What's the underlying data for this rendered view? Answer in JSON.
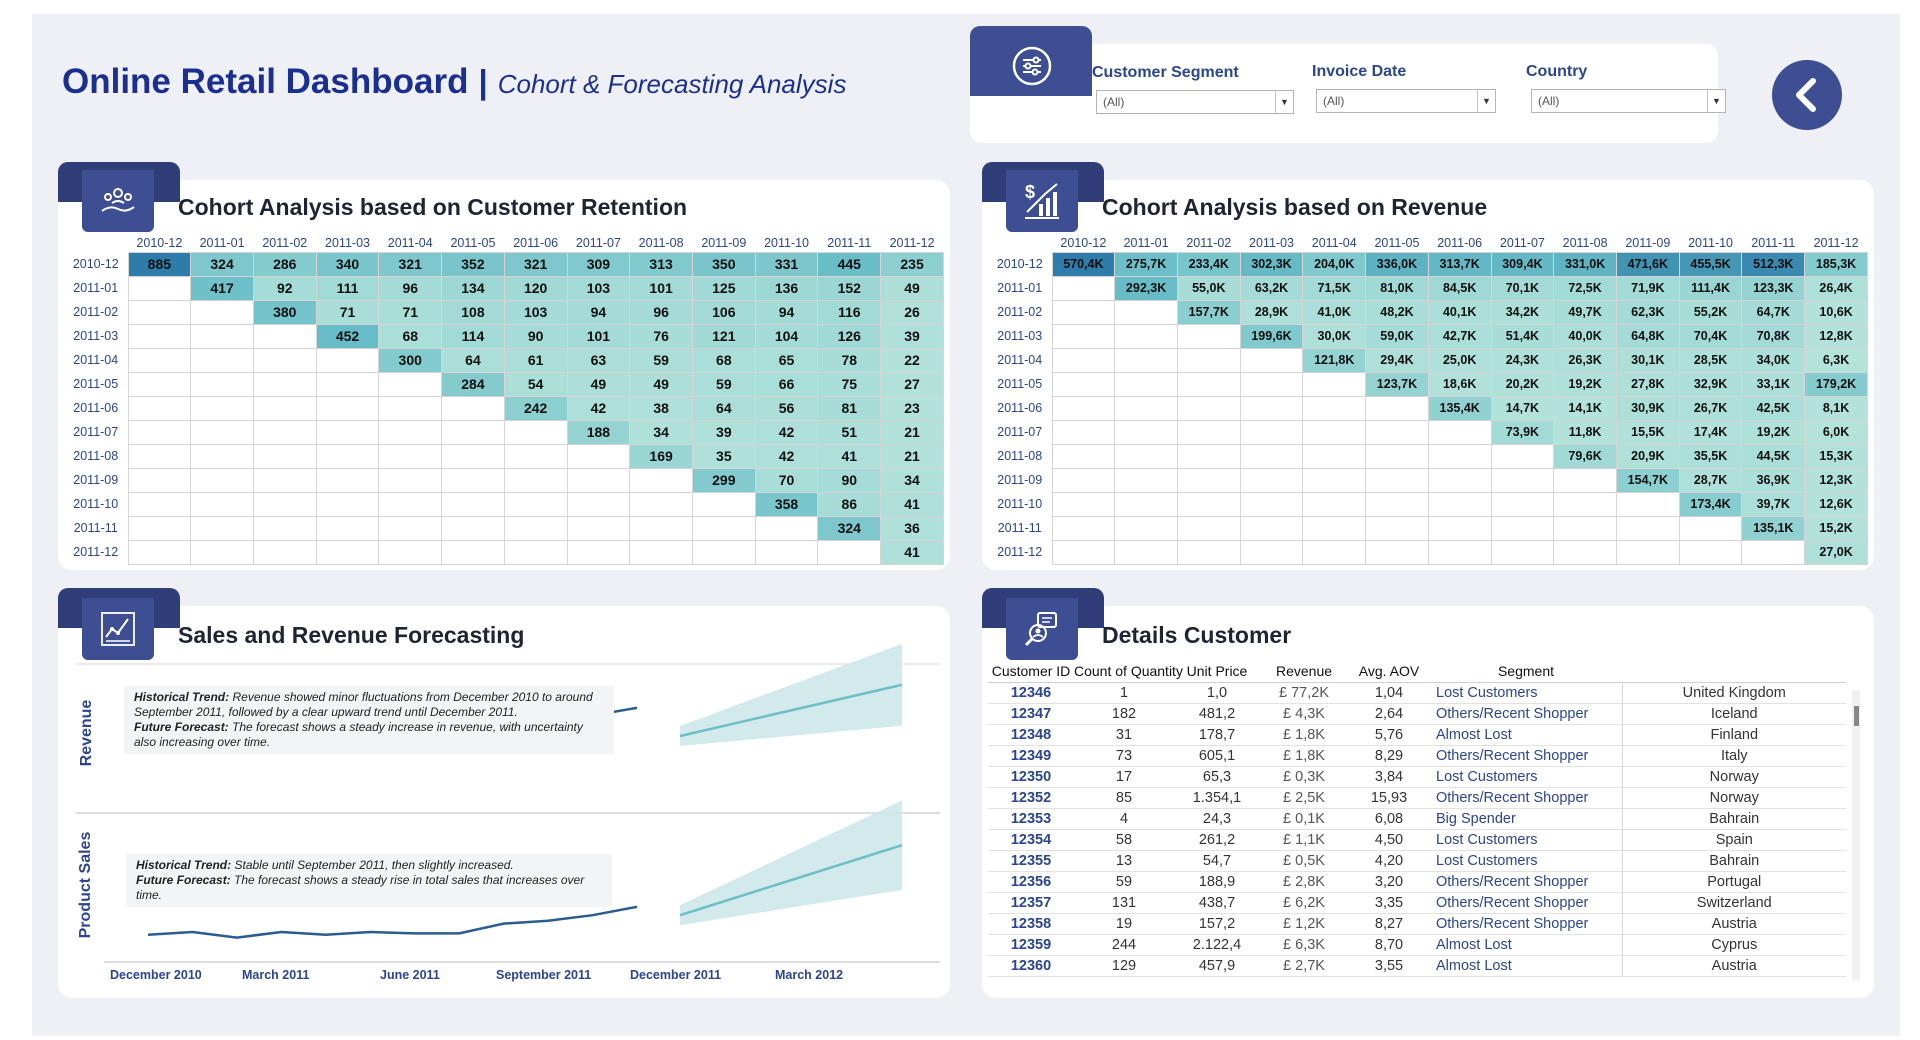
{
  "header": {
    "title": "Online Retail Dashboard",
    "separator": "|",
    "subtitle": "Cohort & Forecasting Analysis"
  },
  "filters": [
    {
      "label": "Customer Segment",
      "value": "(All)"
    },
    {
      "label": "Invoice Date",
      "value": "(All)"
    },
    {
      "label": "Country",
      "value": "(All)"
    }
  ],
  "colors": {
    "brand": "#1b2f8f",
    "tab_dark": "#2f3d78",
    "tab_icon": "#3e4e92",
    "heat_high": "#2f79a9",
    "heat_mid": "#5fb3c3",
    "heat_low": "#a8ddd2",
    "line": "#2b5c8f",
    "forecast": "#6dbec6"
  },
  "retention": {
    "title": "Cohort Analysis based on Customer Retention",
    "icon": "users-hand-icon",
    "columns": [
      "2010-12",
      "2011-01",
      "2011-02",
      "2011-03",
      "2011-04",
      "2011-05",
      "2011-06",
      "2011-07",
      "2011-08",
      "2011-09",
      "2011-10",
      "2011-11",
      "2011-12"
    ],
    "rows": [
      {
        "label": "2010-12",
        "values": [
          "885",
          "324",
          "286",
          "340",
          "321",
          "352",
          "321",
          "309",
          "313",
          "350",
          "331",
          "445",
          "235"
        ]
      },
      {
        "label": "2011-01",
        "values": [
          "",
          "417",
          "92",
          "111",
          "96",
          "134",
          "120",
          "103",
          "101",
          "125",
          "136",
          "152",
          "49"
        ]
      },
      {
        "label": "2011-02",
        "values": [
          "",
          "",
          "380",
          "71",
          "71",
          "108",
          "103",
          "94",
          "96",
          "106",
          "94",
          "116",
          "26"
        ]
      },
      {
        "label": "2011-03",
        "values": [
          "",
          "",
          "",
          "452",
          "68",
          "114",
          "90",
          "101",
          "76",
          "121",
          "104",
          "126",
          "39"
        ]
      },
      {
        "label": "2011-04",
        "values": [
          "",
          "",
          "",
          "",
          "300",
          "64",
          "61",
          "63",
          "59",
          "68",
          "65",
          "78",
          "22"
        ]
      },
      {
        "label": "2011-05",
        "values": [
          "",
          "",
          "",
          "",
          "",
          "284",
          "54",
          "49",
          "49",
          "59",
          "66",
          "75",
          "27"
        ]
      },
      {
        "label": "2011-06",
        "values": [
          "",
          "",
          "",
          "",
          "",
          "",
          "242",
          "42",
          "38",
          "64",
          "56",
          "81",
          "23"
        ]
      },
      {
        "label": "2011-07",
        "values": [
          "",
          "",
          "",
          "",
          "",
          "",
          "",
          "188",
          "34",
          "39",
          "42",
          "51",
          "21"
        ]
      },
      {
        "label": "2011-08",
        "values": [
          "",
          "",
          "",
          "",
          "",
          "",
          "",
          "",
          "169",
          "35",
          "42",
          "41",
          "21"
        ]
      },
      {
        "label": "2011-09",
        "values": [
          "",
          "",
          "",
          "",
          "",
          "",
          "",
          "",
          "",
          "299",
          "70",
          "90",
          "34"
        ]
      },
      {
        "label": "2011-10",
        "values": [
          "",
          "",
          "",
          "",
          "",
          "",
          "",
          "",
          "",
          "",
          "358",
          "86",
          "41"
        ]
      },
      {
        "label": "2011-11",
        "values": [
          "",
          "",
          "",
          "",
          "",
          "",
          "",
          "",
          "",
          "",
          "",
          "324",
          "36"
        ]
      },
      {
        "label": "2011-12",
        "values": [
          "",
          "",
          "",
          "",
          "",
          "",
          "",
          "",
          "",
          "",
          "",
          "",
          "41"
        ]
      }
    ]
  },
  "revenue": {
    "title": "Cohort Analysis based on Revenue",
    "icon": "dollar-chart-icon",
    "columns": [
      "2010-12",
      "2011-01",
      "2011-02",
      "2011-03",
      "2011-04",
      "2011-05",
      "2011-06",
      "2011-07",
      "2011-08",
      "2011-09",
      "2011-10",
      "2011-11",
      "2011-12"
    ],
    "rows": [
      {
        "label": "2010-12",
        "values": [
          "570,4K",
          "275,7K",
          "233,4K",
          "302,3K",
          "204,0K",
          "336,0K",
          "313,7K",
          "309,4K",
          "331,0K",
          "471,6K",
          "455,5K",
          "512,3K",
          "185,3K"
        ]
      },
      {
        "label": "2011-01",
        "values": [
          "",
          "292,3K",
          "55,0K",
          "63,2K",
          "71,5K",
          "81,0K",
          "84,5K",
          "70,1K",
          "72,5K",
          "71,9K",
          "111,4K",
          "123,3K",
          "26,4K"
        ]
      },
      {
        "label": "2011-02",
        "values": [
          "",
          "",
          "157,7K",
          "28,9K",
          "41,0K",
          "48,2K",
          "40,1K",
          "34,2K",
          "49,7K",
          "62,3K",
          "55,2K",
          "64,7K",
          "10,6K"
        ]
      },
      {
        "label": "2011-03",
        "values": [
          "",
          "",
          "",
          "199,6K",
          "30,0K",
          "59,0K",
          "42,7K",
          "51,4K",
          "40,0K",
          "64,8K",
          "70,4K",
          "70,8K",
          "12,8K"
        ]
      },
      {
        "label": "2011-04",
        "values": [
          "",
          "",
          "",
          "",
          "121,8K",
          "29,4K",
          "25,0K",
          "24,3K",
          "26,3K",
          "30,1K",
          "28,5K",
          "34,0K",
          "6,3K"
        ]
      },
      {
        "label": "2011-05",
        "values": [
          "",
          "",
          "",
          "",
          "",
          "123,7K",
          "18,6K",
          "20,2K",
          "19,2K",
          "27,8K",
          "32,9K",
          "33,1K",
          "179,2K"
        ]
      },
      {
        "label": "2011-06",
        "values": [
          "",
          "",
          "",
          "",
          "",
          "",
          "135,4K",
          "14,7K",
          "14,1K",
          "30,9K",
          "26,7K",
          "42,5K",
          "8,1K"
        ]
      },
      {
        "label": "2011-07",
        "values": [
          "",
          "",
          "",
          "",
          "",
          "",
          "",
          "73,9K",
          "11,8K",
          "15,5K",
          "17,4K",
          "19,2K",
          "6,0K"
        ]
      },
      {
        "label": "2011-08",
        "values": [
          "",
          "",
          "",
          "",
          "",
          "",
          "",
          "",
          "79,6K",
          "20,9K",
          "35,5K",
          "44,5K",
          "15,3K"
        ]
      },
      {
        "label": "2011-09",
        "values": [
          "",
          "",
          "",
          "",
          "",
          "",
          "",
          "",
          "",
          "154,7K",
          "28,7K",
          "36,9K",
          "12,3K"
        ]
      },
      {
        "label": "2011-10",
        "values": [
          "",
          "",
          "",
          "",
          "",
          "",
          "",
          "",
          "",
          "",
          "173,4K",
          "39,7K",
          "12,6K"
        ]
      },
      {
        "label": "2011-11",
        "values": [
          "",
          "",
          "",
          "",
          "",
          "",
          "",
          "",
          "",
          "",
          "",
          "135,1K",
          "15,2K"
        ]
      },
      {
        "label": "2011-12",
        "values": [
          "",
          "",
          "",
          "",
          "",
          "",
          "",
          "",
          "",
          "",
          "",
          "",
          "27,0K"
        ]
      }
    ]
  },
  "forecast": {
    "title": "Sales and Revenue Forecasting",
    "icon": "forecast-chart-icon",
    "revenue_label": "Revenue",
    "sales_label": "Product Sales",
    "revenue_note": {
      "h_label": "Historical Trend:",
      "h_text": " Revenue showed minor fluctuations from December 2010 to around September 2011, followed by a clear upward trend until December 2011.",
      "f_label": "Future Forecast:",
      "f_text": " The forecast shows a steady increase in revenue, with uncertainty also increasing over time."
    },
    "sales_note": {
      "h_label": "Historical Trend:",
      "h_text": " Stable until September 2011, then slightly increased.",
      "f_label": "Future Forecast:",
      "f_text": " The forecast shows a steady rise in total sales that increases over time."
    },
    "x_ticks": [
      "December 2010",
      "March 2011",
      "June 2011",
      "September 2011",
      "December 2011",
      "March 2012"
    ],
    "revenue_hist": [
      0.42,
      0.42,
      0.38,
      0.45,
      0.39,
      0.5,
      0.48,
      0.45,
      0.47,
      0.62,
      0.66,
      0.72
    ],
    "revenue_fc": [
      0.5,
      0.9
    ],
    "sales_hist": [
      0.18,
      0.2,
      0.16,
      0.2,
      0.18,
      0.2,
      0.19,
      0.19,
      0.26,
      0.28,
      0.32,
      0.38
    ],
    "sales_fc": [
      0.32,
      0.82
    ]
  },
  "details": {
    "title": "Details Customer",
    "icon": "customer-search-icon",
    "headers": [
      "Customer ID",
      "Count of Quantity",
      "Unit Price",
      "Revenue",
      "Avg. AOV",
      "Segment",
      ""
    ],
    "rows": [
      [
        "12346",
        "1",
        "1,0",
        "£ 77,2K",
        "1,04",
        "Lost Customers",
        "United Kingdom"
      ],
      [
        "12347",
        "182",
        "481,2",
        "£ 4,3K",
        "2,64",
        "Others/Recent Shopper",
        "Iceland"
      ],
      [
        "12348",
        "31",
        "178,7",
        "£ 1,8K",
        "5,76",
        "Almost Lost",
        "Finland"
      ],
      [
        "12349",
        "73",
        "605,1",
        "£ 1,8K",
        "8,29",
        "Others/Recent Shopper",
        "Italy"
      ],
      [
        "12350",
        "17",
        "65,3",
        "£ 0,3K",
        "3,84",
        "Lost Customers",
        "Norway"
      ],
      [
        "12352",
        "85",
        "1.354,1",
        "£ 2,5K",
        "15,93",
        "Others/Recent Shopper",
        "Norway"
      ],
      [
        "12353",
        "4",
        "24,3",
        "£ 0,1K",
        "6,08",
        "Big Spender",
        "Bahrain"
      ],
      [
        "12354",
        "58",
        "261,2",
        "£ 1,1K",
        "4,50",
        "Lost Customers",
        "Spain"
      ],
      [
        "12355",
        "13",
        "54,7",
        "£ 0,5K",
        "4,20",
        "Lost Customers",
        "Bahrain"
      ],
      [
        "12356",
        "59",
        "188,9",
        "£ 2,8K",
        "3,20",
        "Others/Recent Shopper",
        "Portugal"
      ],
      [
        "12357",
        "131",
        "438,7",
        "£ 6,2K",
        "3,35",
        "Others/Recent Shopper",
        "Switzerland"
      ],
      [
        "12358",
        "19",
        "157,2",
        "£ 1,2K",
        "8,27",
        "Others/Recent Shopper",
        "Austria"
      ],
      [
        "12359",
        "244",
        "2.122,4",
        "£ 6,3K",
        "8,70",
        "Almost Lost",
        "Cyprus"
      ],
      [
        "12360",
        "129",
        "457,9",
        "£ 2,7K",
        "3,55",
        "Almost Lost",
        "Austria"
      ]
    ]
  }
}
